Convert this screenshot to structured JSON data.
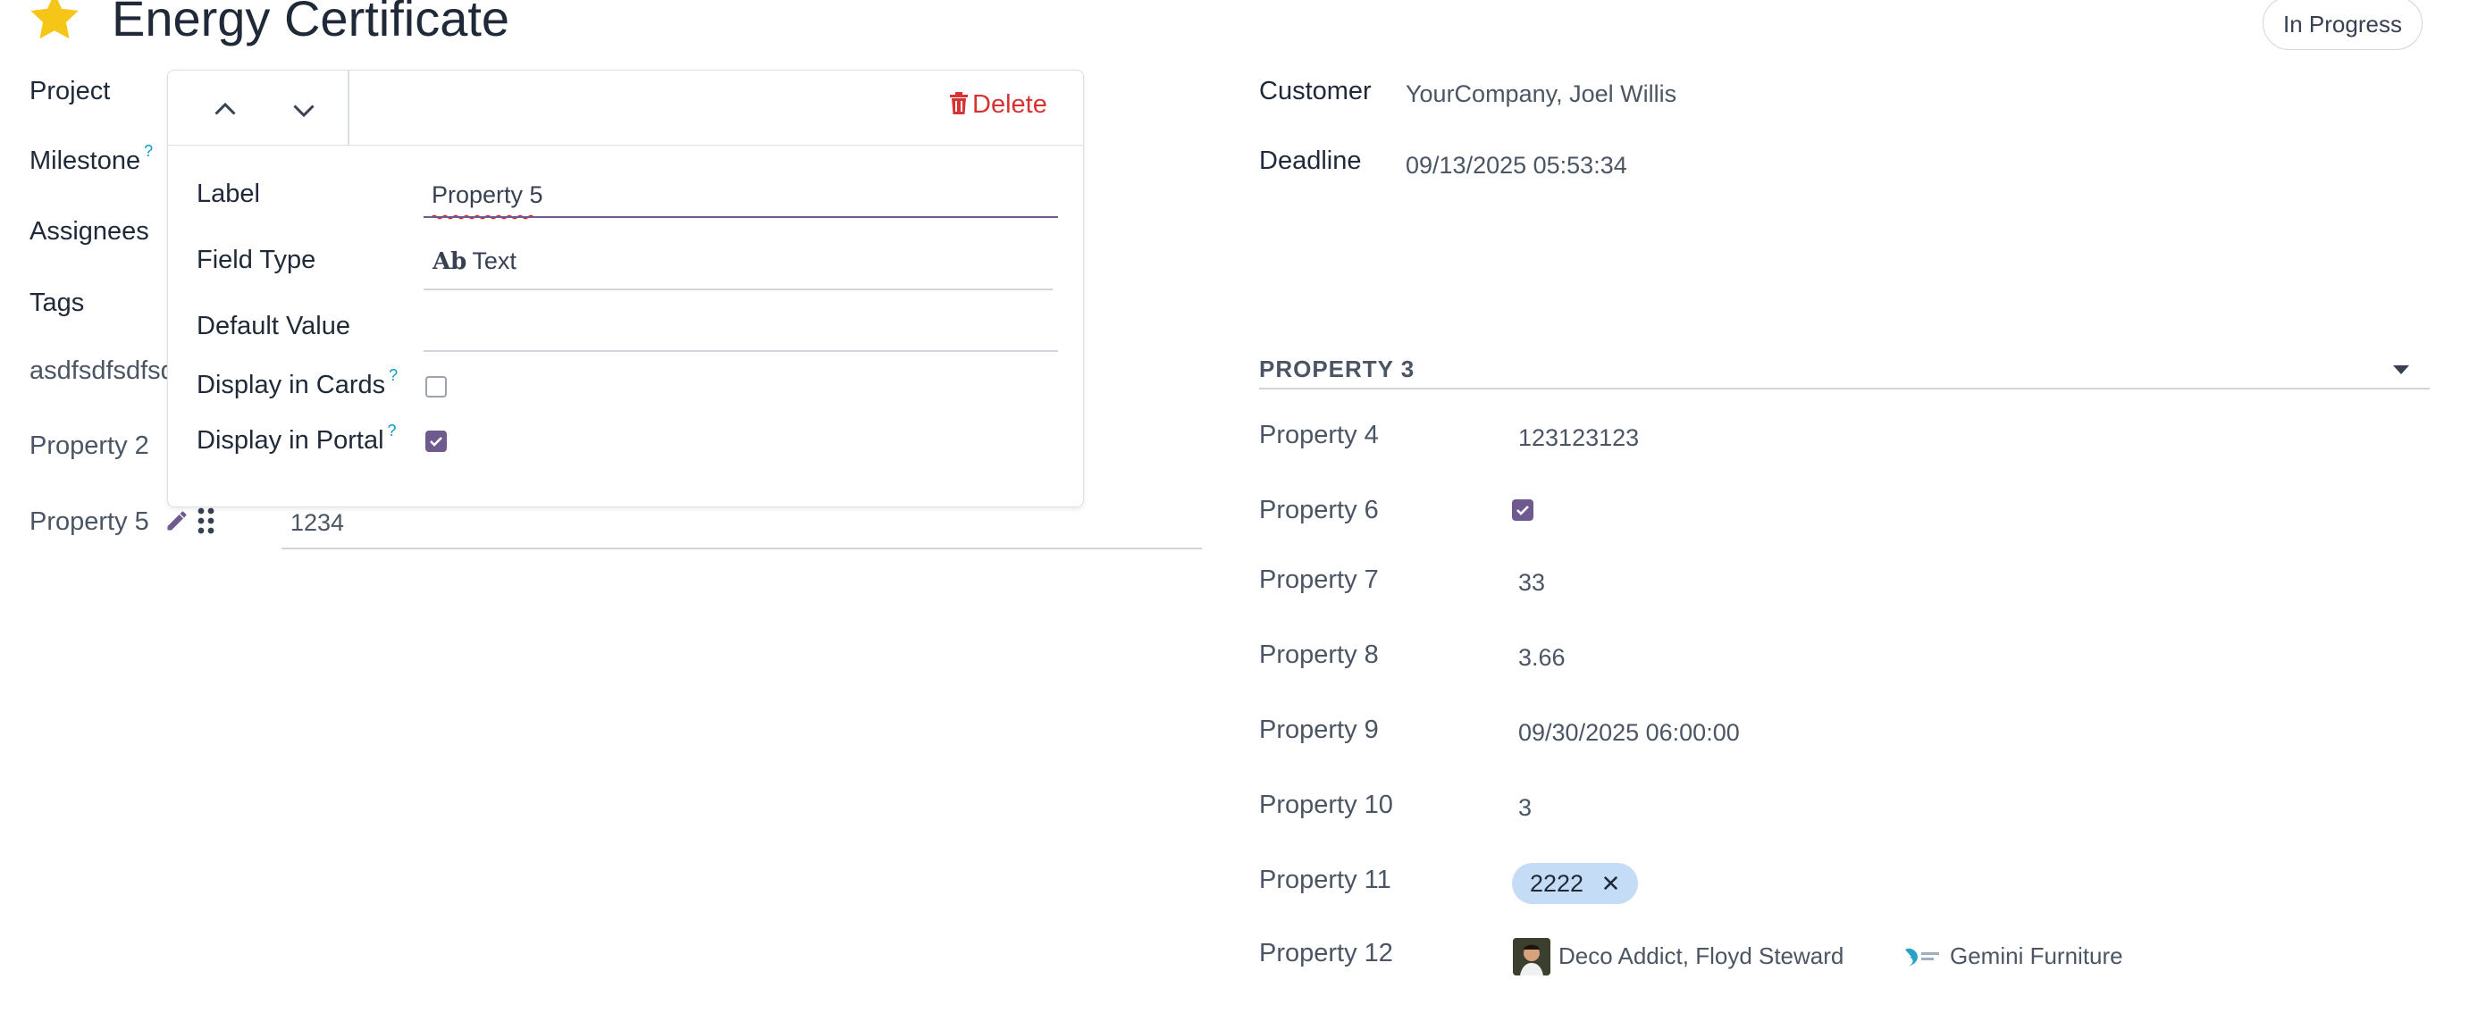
{
  "header": {
    "title": "Energy Certificate",
    "status": "In Progress"
  },
  "left_fields": {
    "project_label": "Project",
    "milestone_label": "Milestone",
    "milestone_help": "?",
    "assignees_label": "Assignees",
    "tags_label": "Tags",
    "custom_label": "asdfsdfsdfsd",
    "property2_label": "Property 2",
    "property5_label": "Property 5",
    "property5_value": "1234"
  },
  "popover": {
    "delete_label": "Delete",
    "label_field": "Label",
    "label_value": "Property 5",
    "field_type_label": "Field Type",
    "field_type_icon_text": "Ab",
    "field_type_value": "Text",
    "default_value_label": "Default Value",
    "default_value_value": "",
    "display_cards_label": "Display in Cards",
    "display_cards_help": "?",
    "display_cards_checked": false,
    "display_portal_label": "Display in Portal",
    "display_portal_help": "?",
    "display_portal_checked": true
  },
  "right_fields": {
    "customer_label": "Customer",
    "customer_value": "YourCompany, Joel Willis",
    "deadline_label": "Deadline",
    "deadline_value": "09/13/2025 05:53:34"
  },
  "properties_section": {
    "title": "PROPERTY 3",
    "rows": [
      {
        "label": "Property 4",
        "value": "123123123"
      },
      {
        "label": "Property 6",
        "value": ""
      },
      {
        "label": "Property 7",
        "value": "33"
      },
      {
        "label": "Property 8",
        "value": "3.66"
      },
      {
        "label": "Property 9",
        "value": "09/30/2025 06:00:00"
      },
      {
        "label": "Property 10",
        "value": "3"
      },
      {
        "label": "Property 11",
        "value": ""
      },
      {
        "label": "Property 12",
        "value": ""
      }
    ],
    "property6_checked": true,
    "property11_tag": "2222",
    "property12_partner1": "Deco Addict, Floyd Steward",
    "property12_partner2": "Gemini Furniture"
  },
  "colors": {
    "accent": "#6f5a8f",
    "star": "#f5c518",
    "delete": "#d63333",
    "tag_bg": "#c5dcf7"
  }
}
